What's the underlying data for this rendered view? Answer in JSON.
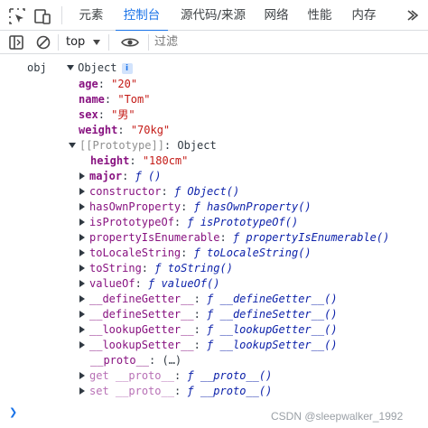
{
  "tabs": [
    {
      "label": "元素"
    },
    {
      "label": "控制台"
    },
    {
      "label": "源代码/来源"
    },
    {
      "label": "网络"
    },
    {
      "label": "性能"
    },
    {
      "label": "内存"
    }
  ],
  "toolbar": {
    "context": "top",
    "filter_placeholder": "过滤"
  },
  "console": {
    "var_name": "obj",
    "object_label": "Object",
    "info_badge": "i",
    "props": [
      {
        "key": "age",
        "value": "\"20\""
      },
      {
        "key": "name",
        "value": "\"Tom\""
      },
      {
        "key": "sex",
        "value": "\"男\""
      },
      {
        "key": "weight",
        "value": "\"70kg\""
      }
    ],
    "prototype": {
      "label": "[[Prototype]]",
      "value": "Object",
      "height": {
        "key": "height",
        "value": "\"180cm\""
      },
      "major": {
        "key": "major",
        "value": "ƒ ()"
      },
      "methods": [
        {
          "key": "constructor",
          "value": "ƒ Object()"
        },
        {
          "key": "hasOwnProperty",
          "value": "ƒ hasOwnProperty()"
        },
        {
          "key": "isPrototypeOf",
          "value": "ƒ isPrototypeOf()"
        },
        {
          "key": "propertyIsEnumerable",
          "value": "ƒ propertyIsEnumerable()"
        },
        {
          "key": "toLocaleString",
          "value": "ƒ toLocaleString()"
        },
        {
          "key": "toString",
          "value": "ƒ toString()"
        },
        {
          "key": "valueOf",
          "value": "ƒ valueOf()"
        },
        {
          "key": "__defineGetter__",
          "value": "ƒ __defineGetter__()"
        },
        {
          "key": "__defineSetter__",
          "value": "ƒ __defineSetter__()"
        },
        {
          "key": "__lookupGetter__",
          "value": "ƒ __lookupGetter__()"
        },
        {
          "key": "__lookupSetter__",
          "value": "ƒ __lookupSetter__()"
        }
      ],
      "proto_key": "__proto__",
      "proto_value": "(…)",
      "get_proto": {
        "prefix": "get",
        "key": "__proto__",
        "value": "ƒ __proto__()"
      },
      "set_proto": {
        "prefix": "set",
        "key": "__proto__",
        "value": "ƒ __proto__()"
      }
    }
  },
  "watermark": "CSDN @sleepwalker_1992",
  "colors": {
    "accent": "#1a73e8",
    "key": "#881280",
    "string": "#c41a16",
    "function": "#0d22aa"
  }
}
